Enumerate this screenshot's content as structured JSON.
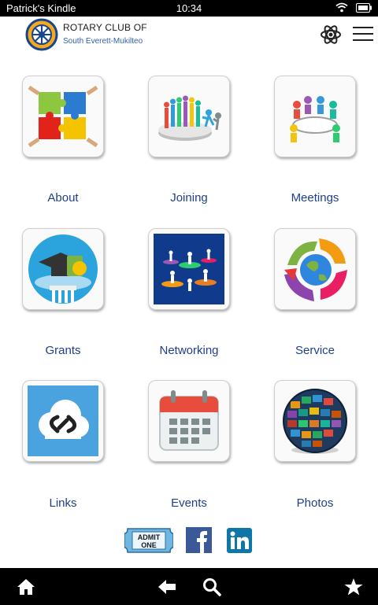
{
  "status": {
    "device_name": "Patrick's Kindle",
    "time": "10:34"
  },
  "header": {
    "title": "ROTARY CLUB OF",
    "subtitle": "South Everett-Mukilteo"
  },
  "tiles": [
    {
      "label": "About",
      "icon": "puzzle-icon"
    },
    {
      "label": "Joining",
      "icon": "people-crowd-icon"
    },
    {
      "label": "Meetings",
      "icon": "meeting-table-icon"
    },
    {
      "label": "Grants",
      "icon": "graduation-money-icon"
    },
    {
      "label": "Networking",
      "icon": "network-people-icon"
    },
    {
      "label": "Service",
      "icon": "helping-hands-globe-icon"
    },
    {
      "label": "Links",
      "icon": "cloud-link-icon"
    },
    {
      "label": "Events",
      "icon": "calendar-icon"
    },
    {
      "label": "Photos",
      "icon": "photo-globe-icon"
    }
  ],
  "social": {
    "ticket_text_line1": "ADMIT",
    "ticket_text_line2": "ONE"
  },
  "colors": {
    "label_blue": "#1f3f87",
    "facebook": "#3b5998",
    "linkedin": "#0e76a8",
    "bar": "#000000"
  }
}
